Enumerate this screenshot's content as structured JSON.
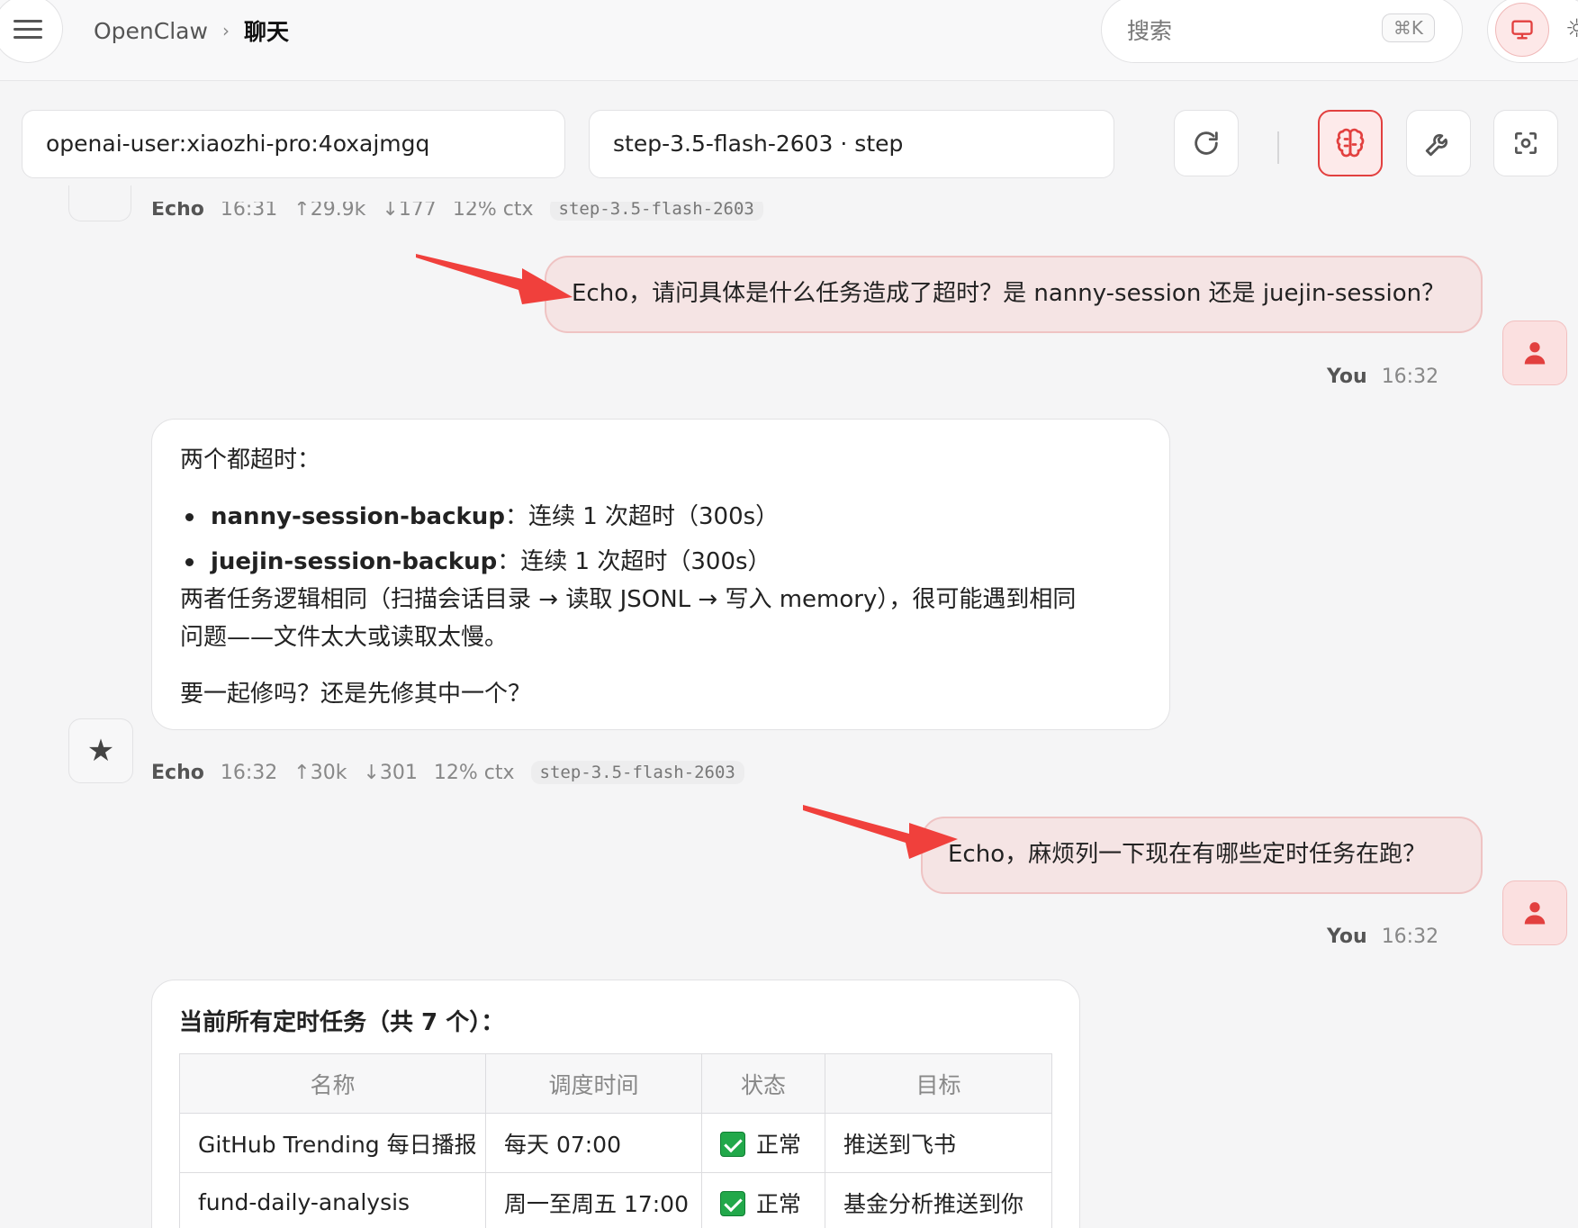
{
  "header": {
    "breadcrumb_root": "OpenClaw",
    "breadcrumb_sep": "›",
    "breadcrumb_current": "聊天",
    "search_placeholder": "搜索",
    "search_shortcut": "⌘K"
  },
  "toolbar": {
    "session": "openai-user:xiaozhi-pro:4oxajmgq",
    "model": "step-3.5-flash-2603 · step"
  },
  "icons": [
    "menu-icon",
    "monitor-icon",
    "sun-icon",
    "refresh-icon",
    "brain-icon",
    "wrench-icon",
    "focus-icon",
    "user-icon",
    "star-icon",
    "check-icon"
  ],
  "colors": {
    "accent": "#e2403f",
    "user_bubble": "#f5e4e4",
    "arrow": "#f0403c",
    "check": "#22a84a"
  },
  "messages": [
    {
      "role": "assistant_cut",
      "meta": {
        "name": "Echo",
        "time": "16:31",
        "up": "↑29.9k",
        "down": "↓177",
        "ctx": "12% ctx",
        "model": "step-3.5-flash-2603"
      }
    },
    {
      "role": "user",
      "text": "Echo，请问具体是什么任务造成了超时？是 nanny-session 还是 juejin-session？",
      "meta": {
        "name": "You",
        "time": "16:32"
      }
    },
    {
      "role": "assistant",
      "intro": "两个都超时：",
      "bullets": [
        {
          "name": "nanny-session-backup",
          "detail": "：连续 1 次超时（300s）"
        },
        {
          "name": "juejin-session-backup",
          "detail": "：连续 1 次超时（300s）"
        }
      ],
      "body_line1": "两者任务逻辑相同（扫描会话目录 → 读取 JSONL → 写入 memory），很可能遇到相同",
      "body_line2": "问题——文件太大或读取太慢。",
      "question": "要一起修吗？还是先修其中一个？",
      "meta": {
        "name": "Echo",
        "time": "16:32",
        "up": "↑30k",
        "down": "↓301",
        "ctx": "12% ctx",
        "model": "step-3.5-flash-2603"
      }
    },
    {
      "role": "user",
      "text": "Echo，麻烦列一下现在有哪些定时任务在跑？",
      "meta": {
        "name": "You",
        "time": "16:32"
      }
    },
    {
      "role": "assistant",
      "title": "当前所有定时任务（共 7 个）：",
      "table": {
        "headers": [
          "名称",
          "调度时间",
          "状态",
          "目标"
        ],
        "rows": [
          [
            "GitHub Trending 每日播报",
            "每天 07:00",
            "正常",
            "推送到飞书"
          ],
          [
            "fund-daily-analysis",
            "周一至周五 17:00",
            "正常",
            "基金分析推送到你"
          ]
        ]
      }
    }
  ]
}
